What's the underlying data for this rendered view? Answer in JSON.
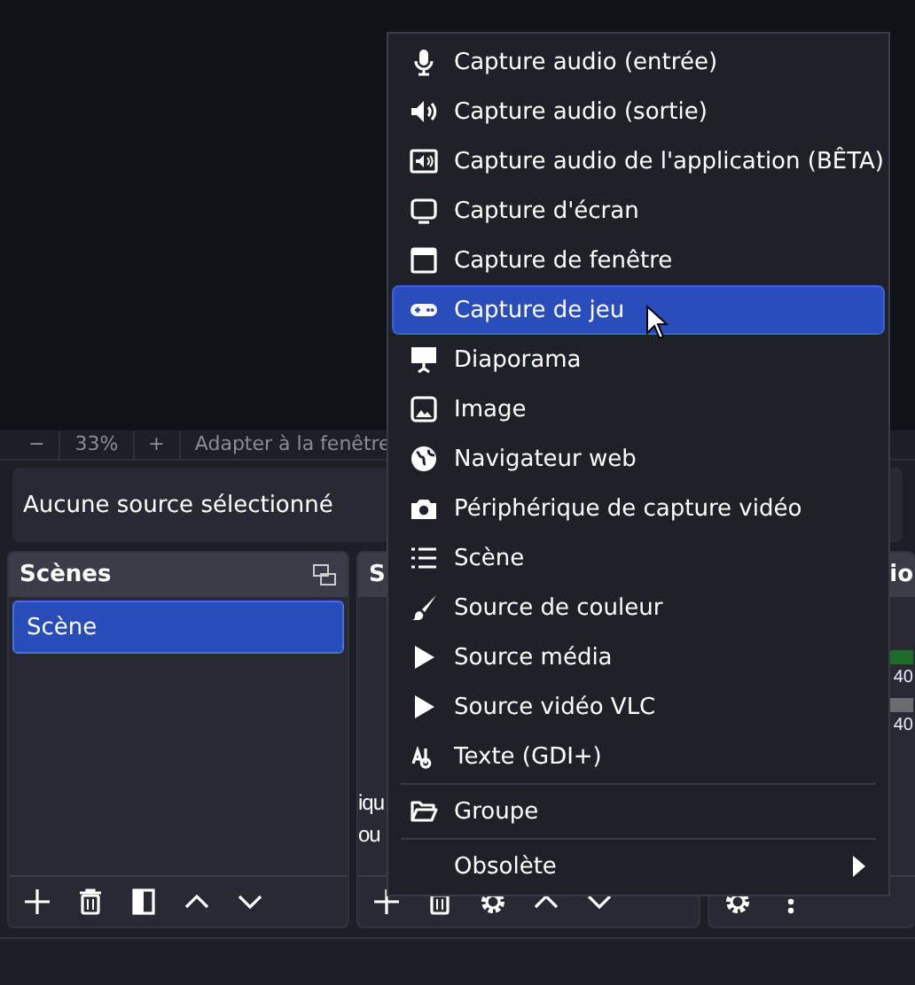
{
  "preview_controls": {
    "zoom_out": "−",
    "zoom": "33%",
    "zoom_in": "+",
    "fit": "Adapter à la fenêtre"
  },
  "source_bar": {
    "text": "Aucune source sélectionné"
  },
  "scenes": {
    "title": "Scènes",
    "items": [
      {
        "label": "Scène",
        "selected": true
      }
    ]
  },
  "sources": {
    "title": "S",
    "fragments": [
      "iqu",
      "ou"
    ]
  },
  "mixer": {
    "title": "io",
    "channels": [
      {
        "reading": "40"
      },
      {
        "reading": "40"
      }
    ]
  },
  "menu": {
    "items": [
      {
        "label": "Capture audio (entrée)",
        "kind": "microphone",
        "selected": false
      },
      {
        "label": "Capture audio (sortie)",
        "kind": "speaker",
        "selected": false
      },
      {
        "label": "Capture audio de l'application (BÊTA)",
        "kind": "app-audio",
        "selected": false
      },
      {
        "label": "Capture d'écran",
        "kind": "monitor",
        "selected": false
      },
      {
        "label": "Capture de fenêtre",
        "kind": "window",
        "selected": false
      },
      {
        "label": "Capture de jeu",
        "kind": "gamepad",
        "selected": true
      },
      {
        "label": "Diaporama",
        "kind": "slideshow",
        "selected": false
      },
      {
        "label": "Image",
        "kind": "image",
        "selected": false
      },
      {
        "label": "Navigateur web",
        "kind": "globe",
        "selected": false
      },
      {
        "label": "Périphérique de capture vidéo",
        "kind": "camera",
        "selected": false
      },
      {
        "label": "Scène",
        "kind": "list",
        "selected": false
      },
      {
        "label": "Source de couleur",
        "kind": "brush",
        "selected": false
      },
      {
        "label": "Source média",
        "kind": "play",
        "selected": false
      },
      {
        "label": "Source vidéo VLC",
        "kind": "play",
        "selected": false
      },
      {
        "label": "Texte (GDI+)",
        "kind": "text",
        "selected": false
      },
      {
        "label": "Groupe",
        "kind": "folder",
        "selected": false,
        "separator_before": true
      },
      {
        "label": "Obsolète",
        "kind": "none",
        "selected": false,
        "separator_before": true,
        "submenu": true
      }
    ]
  }
}
